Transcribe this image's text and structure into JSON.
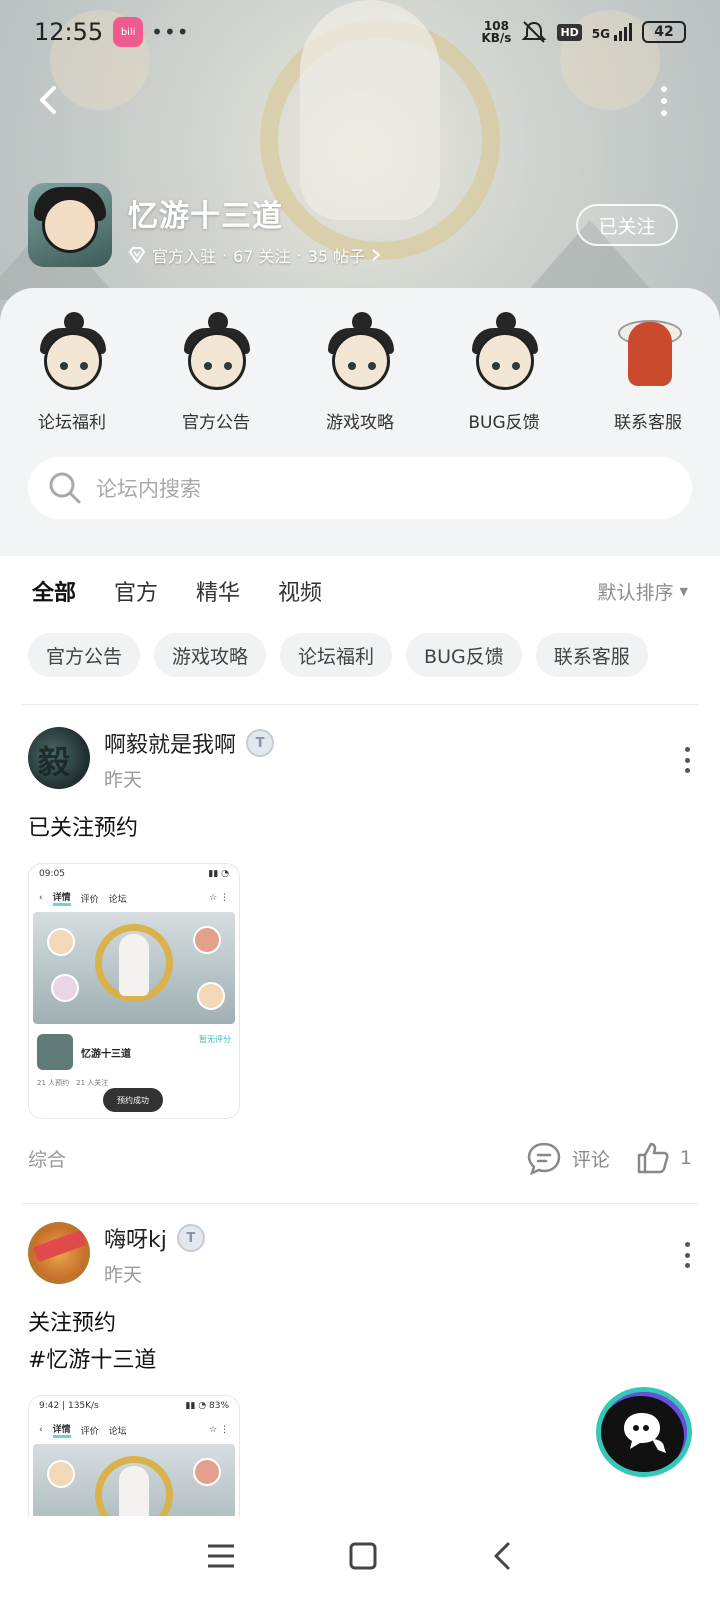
{
  "status_bar": {
    "time": "12:55",
    "net_speed_value": "108",
    "net_speed_unit": "KB/s",
    "hd": "HD",
    "signal": "5G",
    "battery": "42"
  },
  "header": {
    "game_title": "忆游十三道",
    "official": "官方入驻",
    "follows": "67 关注",
    "posts": "35 帖子",
    "follow_button": "已关注"
  },
  "quick_nav": [
    {
      "label": "论坛福利"
    },
    {
      "label": "官方公告"
    },
    {
      "label": "游戏攻略"
    },
    {
      "label": "BUG反馈"
    },
    {
      "label": "联系客服"
    }
  ],
  "search": {
    "placeholder": "论坛内搜索"
  },
  "tabs": [
    {
      "label": "全部",
      "active": true
    },
    {
      "label": "官方"
    },
    {
      "label": "精华"
    },
    {
      "label": "视频"
    }
  ],
  "sort_label": "默认排序",
  "chips": [
    "官方公告",
    "游戏攻略",
    "论坛福利",
    "BUG反馈",
    "联系客服"
  ],
  "posts": [
    {
      "author": "啊毅就是我啊",
      "avatar_text": "毅",
      "level": "T",
      "time": "昨天",
      "text_lines": [
        "已关注预约"
      ],
      "thumb": {
        "time": "09:05",
        "tab_detail": "详情",
        "tab_review": "评价",
        "tab_forum": "论坛",
        "game": "忆游十三道",
        "rating": "暂无评分",
        "stats": "21 人预约　21 人关注",
        "toast": "预约成功"
      },
      "category": "综合",
      "comment_label": "评论",
      "likes": "1"
    },
    {
      "author": "嗨呀kj",
      "level": "T",
      "time": "昨天",
      "text_lines": [
        "关注预约",
        "#忆游十三道"
      ],
      "thumb": {
        "time": "9:42 | 135K/s",
        "tab_detail": "详情",
        "tab_review": "评价",
        "tab_forum": "论坛"
      }
    }
  ],
  "colors": {
    "accent": "#3fc8c0",
    "panel_bg": "#f3f4f6"
  }
}
